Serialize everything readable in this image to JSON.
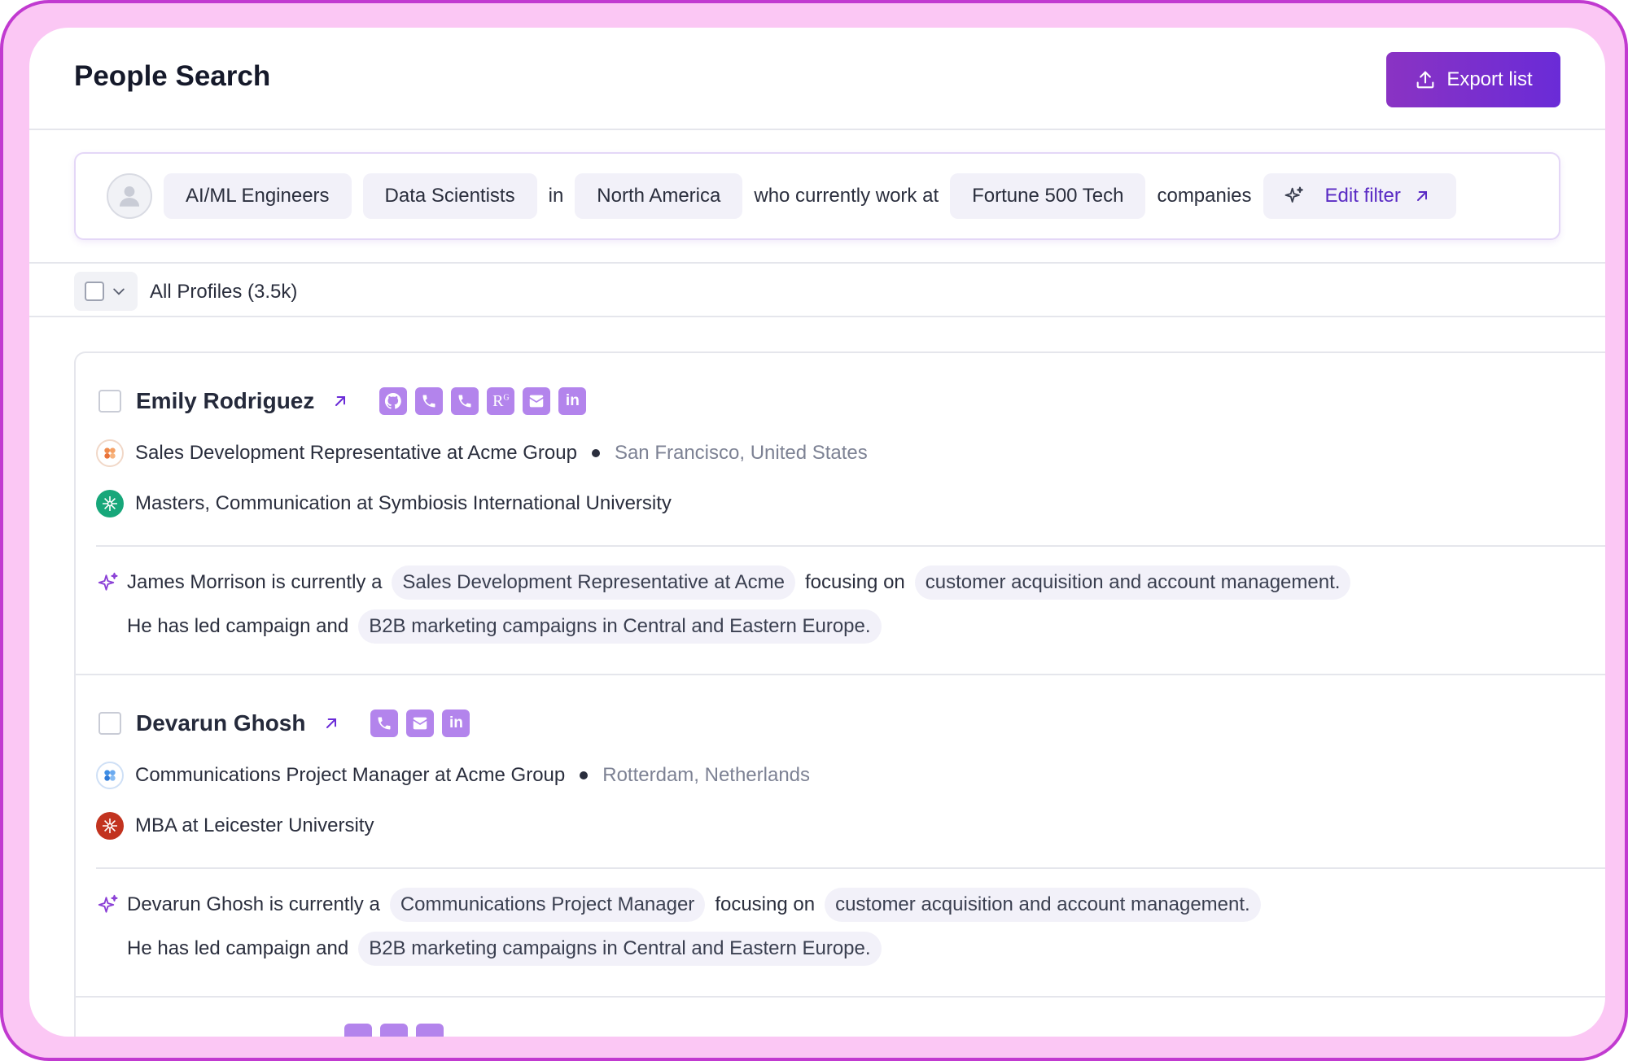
{
  "header": {
    "title": "People Search",
    "export_label": "Export list"
  },
  "filter": {
    "chips": [
      "AI/ML Engineers",
      "Data Scientists",
      "North America",
      "Fortune 500 Tech"
    ],
    "word_in": "in",
    "word_work": "who currently work at",
    "word_companies": "companies",
    "edit_label": "Edit filter"
  },
  "profiles_bar": {
    "label": "All Profiles (3.5k)"
  },
  "colors": {
    "accent": "#6a2bd7",
    "social_icon": "#b384ec",
    "frame": "#fbc7f4"
  },
  "profiles": [
    {
      "name": "Emily Rodriguez",
      "social_icons": [
        "github-icon",
        "phone-icon",
        "phone-icon",
        "researchgate-icon",
        "email-icon",
        "linkedin-icon"
      ],
      "job": "Sales Development Representative at Acme Group",
      "location": "San Francisco, United States",
      "education": "Masters, Communication at Symbiosis International University",
      "summary": {
        "intro": "James Morrison is currently a",
        "role": "Sales Development Representative at Acme",
        "focus_word": "focusing on",
        "focus": "customer acquisition and account management.",
        "led": "He has led campaign and",
        "campaigns": "B2B marketing campaigns in Central and Eastern Europe."
      }
    },
    {
      "name": "Devarun Ghosh",
      "social_icons": [
        "phone-icon",
        "email-icon",
        "linkedin-icon"
      ],
      "job": "Communications Project Manager at Acme Group",
      "location": "Rotterdam, Netherlands",
      "education": "MBA at Leicester University",
      "summary": {
        "intro": "Devarun Ghosh is currently a",
        "role": "Communications Project Manager",
        "focus_word": "focusing on",
        "focus": "customer acquisition and account management.",
        "led": "He has led campaign and",
        "campaigns": "B2B marketing campaigns in Central and Eastern Europe."
      }
    }
  ]
}
